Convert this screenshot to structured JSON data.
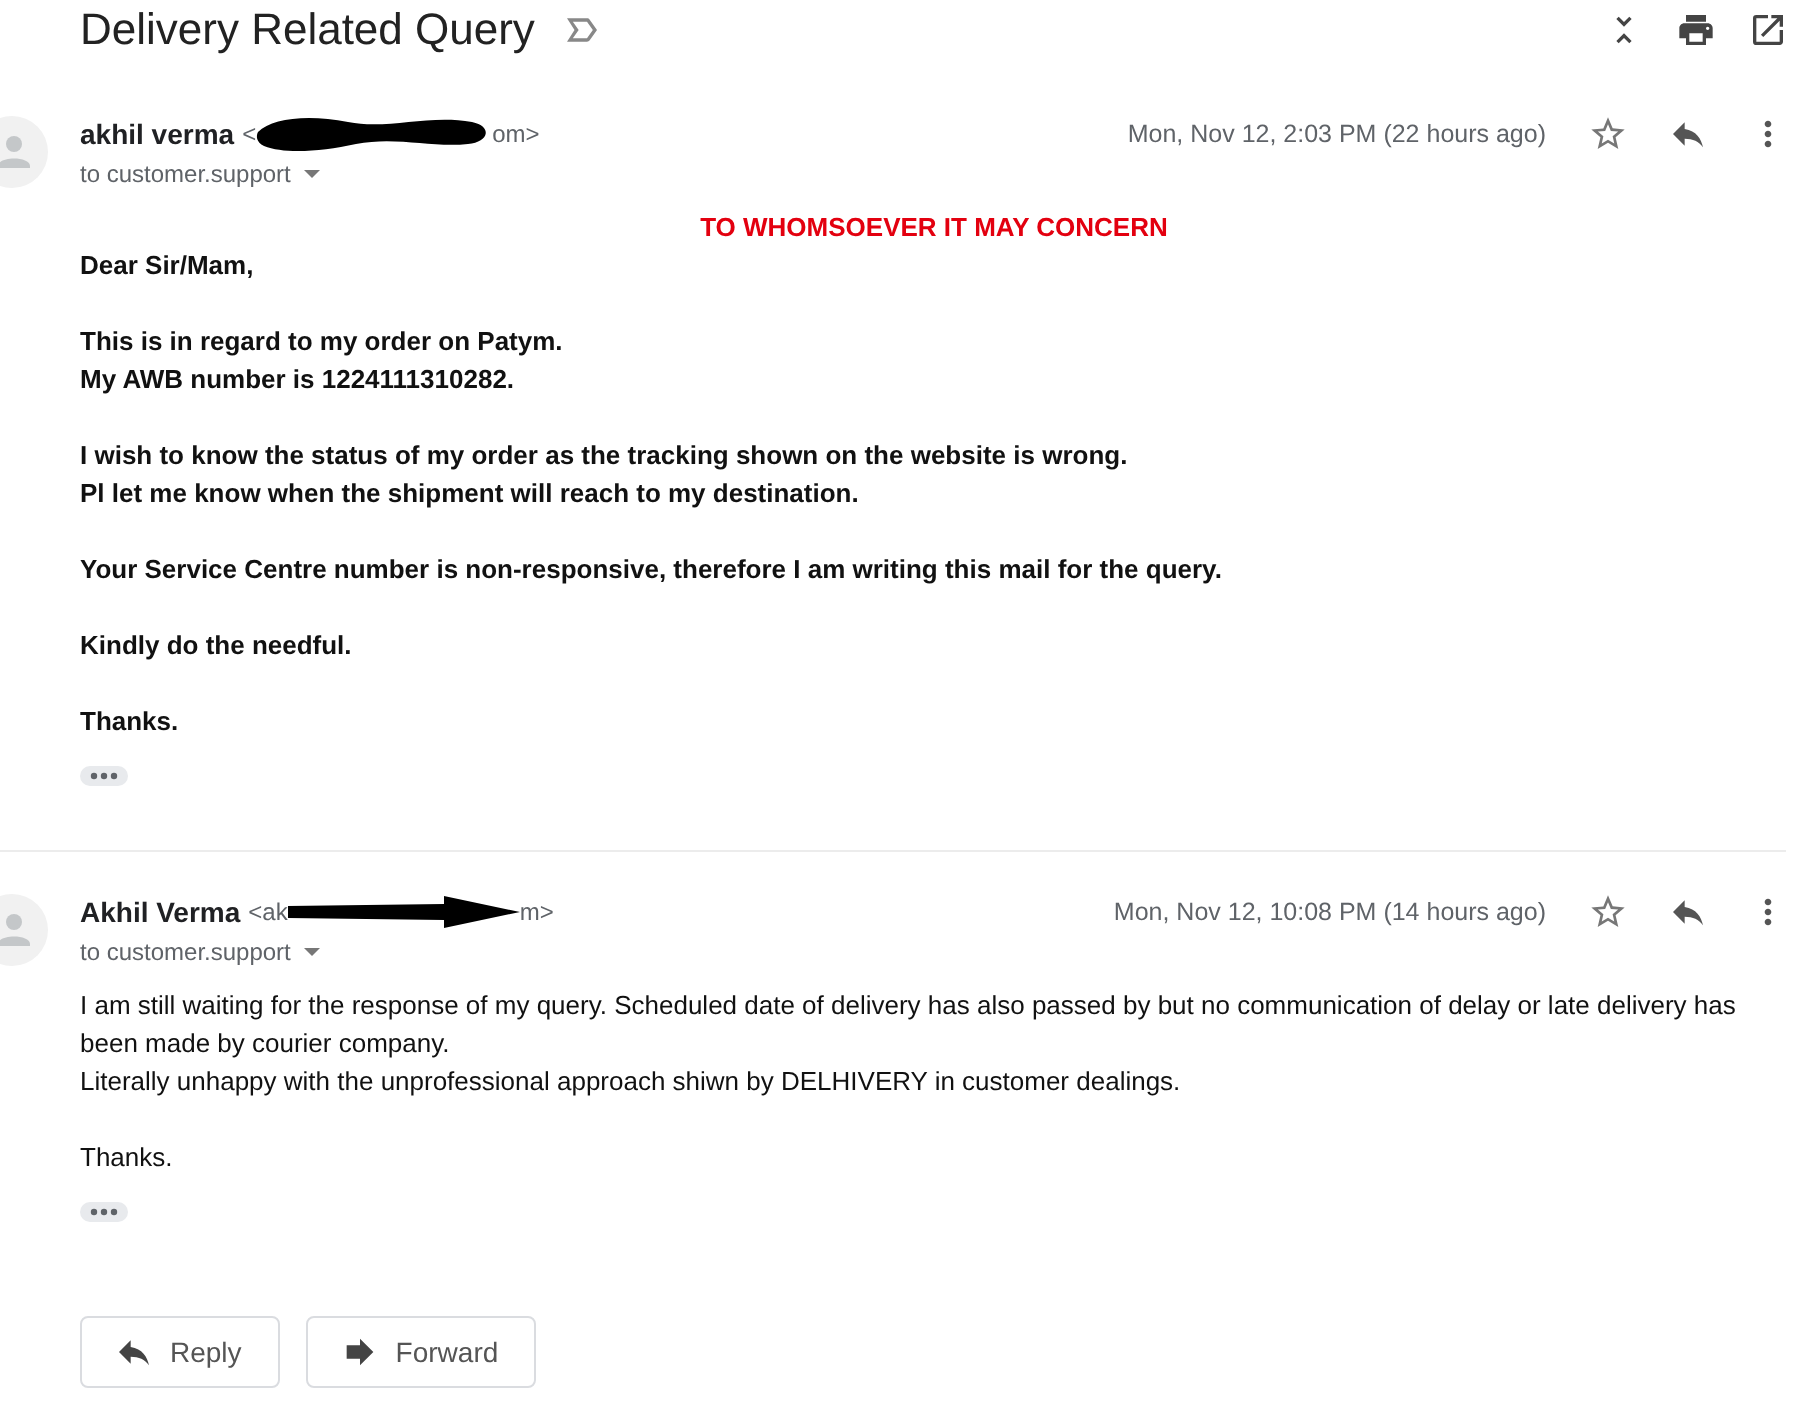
{
  "thread": {
    "subject": "Delivery Related Query",
    "important": false
  },
  "messages": [
    {
      "sender": "akhil verma",
      "email_start": "<",
      "email_end": "om>",
      "recipient": "to customer.support",
      "date": "Mon, Nov 12, 2:03 PM (22 hours ago)",
      "starred": false,
      "bold": true,
      "body": [
        {
          "kind": "heading",
          "lines": [
            "TO WHOMSOEVER IT MAY CONCERN"
          ]
        },
        {
          "kind": "paragraph",
          "lines": [
            "Dear Sir/Mam,"
          ]
        },
        {
          "kind": "paragraph",
          "lines": [
            "This is in regard to my order on Patym.",
            "My AWB number is 1224111310282."
          ]
        },
        {
          "kind": "paragraph",
          "lines": [
            "I wish to know the status of my order as the tracking shown on the website is wrong.",
            "Pl let me know when the shipment will reach to my destination."
          ]
        },
        {
          "kind": "paragraph",
          "lines": [
            "Your Service Centre number is non-responsive, therefore I am writing this mail for the query."
          ]
        },
        {
          "kind": "paragraph",
          "lines": [
            "Kindly do the needful."
          ]
        },
        {
          "kind": "paragraph",
          "lines": [
            "Thanks."
          ]
        }
      ]
    },
    {
      "sender": "Akhil Verma",
      "email_start": "<ak",
      "email_end": "m>",
      "recipient": "to customer.support",
      "date": "Mon, Nov 12, 10:08 PM (14 hours ago)",
      "starred": false,
      "bold": false,
      "body": [
        {
          "kind": "paragraph",
          "lines": [
            "I am still waiting for the response of my query. Scheduled date of delivery has also passed by but no communication of delay or late delivery has been made by courier company.",
            "Literally unhappy with the unprofessional approach shiwn by DELHIVERY in customer dealings."
          ]
        },
        {
          "kind": "paragraph",
          "lines": [
            "Thanks."
          ]
        }
      ]
    }
  ],
  "actions": [
    {
      "kind": "reply",
      "label": "Reply"
    },
    {
      "kind": "forward",
      "label": "Forward"
    }
  ]
}
